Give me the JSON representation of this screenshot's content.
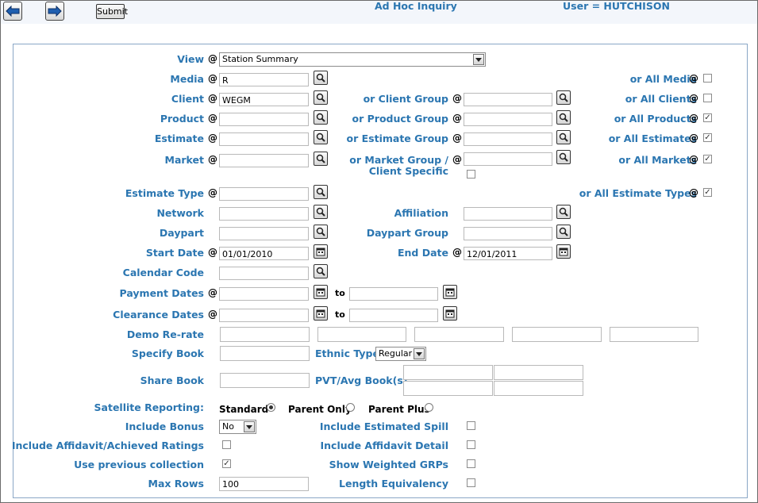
{
  "header": {
    "title": "Ad Hoc Inquiry",
    "user": "User = HUTCHISON",
    "submit_label": "Submit",
    "icons": [
      "back-arrow-icon",
      "forward-arrow-icon"
    ]
  },
  "form": {
    "view": {
      "label": "View",
      "value": "Station Summary"
    },
    "media": {
      "label": "Media",
      "value": "R",
      "all_label": "or All Media",
      "all_checked": false
    },
    "client": {
      "label": "Client",
      "value": "WEGM",
      "group_label": "or Client Group",
      "all_label": "or All Clients",
      "all_checked": false
    },
    "product": {
      "label": "Product",
      "value": "",
      "group_label": "or Product Group",
      "all_label": "or All Products",
      "all_checked": true
    },
    "estimate": {
      "label": "Estimate",
      "value": "",
      "group_label": "or Estimate Group",
      "all_label": "or All Estimates",
      "all_checked": true
    },
    "market": {
      "label": "Market",
      "value": "",
      "group_label_1": "or Market Group /",
      "group_label_2": "Client Specific",
      "all_label": "or All Markets",
      "all_checked": true
    },
    "estimate_type": {
      "label": "Estimate Type",
      "all_label": "or All Estimate Types",
      "all_checked": true
    },
    "network": {
      "label": "Network"
    },
    "affiliation": {
      "label": "Affiliation"
    },
    "daypart": {
      "label": "Daypart"
    },
    "daypart_group": {
      "label": "Daypart Group"
    },
    "start_date": {
      "label": "Start Date",
      "value": "01/01/2010"
    },
    "end_date": {
      "label": "End Date",
      "value": "12/01/2011"
    },
    "calendar_code": {
      "label": "Calendar Code"
    },
    "payment_dates": {
      "label": "Payment Dates",
      "to": "to"
    },
    "clearance_dates": {
      "label": "Clearance Dates",
      "to": "to"
    },
    "demo_rerate": {
      "label": "Demo Re-rate"
    },
    "specify_book": {
      "label": "Specify Book"
    },
    "ethnic_type": {
      "label": "Ethnic Type",
      "value": "Regular"
    },
    "share_book": {
      "label": "Share Book"
    },
    "pvt_avg": {
      "label": "PVT/Avg Book(s)"
    },
    "satellite": {
      "label": "Satellite Reporting:",
      "options": [
        "Standard",
        "Parent Only",
        "Parent Plus"
      ],
      "selected": "Standard"
    },
    "include_bonus": {
      "label": "Include Bonus",
      "value": "No"
    },
    "include_spill": {
      "label": "Include Estimated Spill",
      "checked": false
    },
    "include_affidavit_ratings": {
      "label": "Include Affidavit/Achieved Ratings",
      "checked": false
    },
    "include_affidavit_detail": {
      "label": "Include Affidavit Detail",
      "checked": false
    },
    "use_previous": {
      "label": "Use previous collection",
      "checked": true
    },
    "show_weighted": {
      "label": "Show Weighted GRPs",
      "checked": false
    },
    "max_rows": {
      "label": "Max Rows",
      "value": "100"
    },
    "length_equiv": {
      "label": "Length Equivalency",
      "checked": false
    },
    "at_symbol": "@",
    "check_mark": "✓"
  }
}
